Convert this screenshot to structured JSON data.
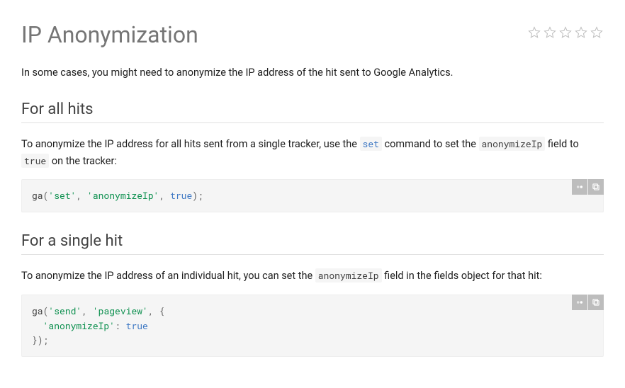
{
  "page": {
    "title": "IP Anonymization",
    "intro": "In some cases, you might need to anonymize the IP address of the hit sent to Google Analytics."
  },
  "rating": {
    "value": 0,
    "max": 5
  },
  "sections": [
    {
      "heading": "For all hits",
      "body_pre": "To anonymize the IP address for all hits sent from a single tracker, use the ",
      "inline1": "set",
      "body_mid": " command to set the ",
      "inline2": "anonymizeIp",
      "body_mid2": " field to ",
      "inline3": "true",
      "body_post": " on the tracker:",
      "code": {
        "fn": "ga",
        "open": "(",
        "arg1": "'set'",
        "sep1": ", ",
        "arg2": "'anonymizeIp'",
        "sep2": ", ",
        "arg3": "true",
        "close": ");"
      }
    },
    {
      "heading": "For a single hit",
      "body_pre": "To anonymize the IP address of an individual hit, you can set the ",
      "inline1": "anonymizeIp",
      "body_post": " field in the fields object for that hit:",
      "code": {
        "fn": "ga",
        "open": "(",
        "arg1": "'send'",
        "sep1": ", ",
        "arg2": "'pageview'",
        "sep2": ", {",
        "line2_indent": "  ",
        "key": "'anonymizeIp'",
        "colon": ": ",
        "val": "true",
        "line3": "});"
      }
    }
  ],
  "toolbar": {
    "theme_label": "toggle-theme",
    "copy_label": "copy-code"
  }
}
